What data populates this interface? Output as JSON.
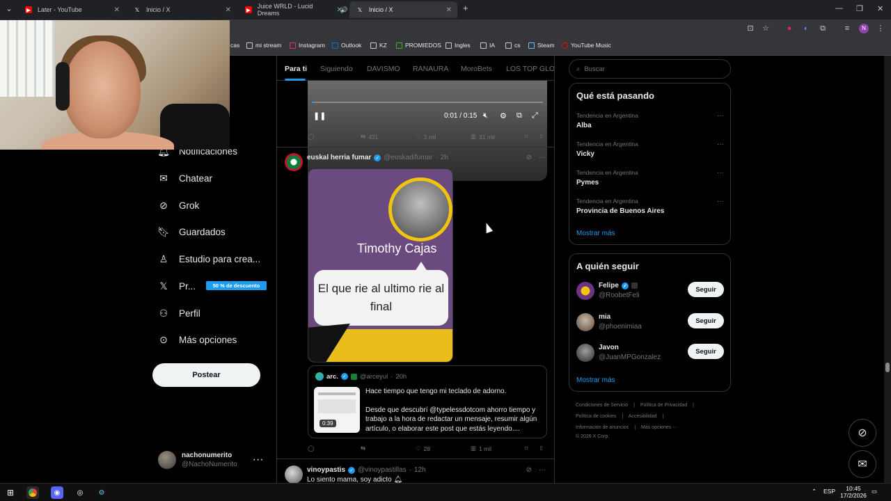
{
  "browser": {
    "tabs": [
      {
        "title": "Later - YouTube",
        "active": false
      },
      {
        "title": "Inicio / X",
        "active": false
      },
      {
        "title": "Juice WRLD - Lucid Dreams",
        "active": false
      },
      {
        "title": "Inicio / X",
        "active": true
      }
    ],
    "new_tab": "+",
    "bookmarks": [
      "cas",
      "mi stream",
      "Instagram",
      "Outlook",
      "KZ",
      "PROMIEDOS",
      "Ingles",
      "IA",
      "cs",
      "Steam",
      "YouTube Music"
    ],
    "profile_initial": "N"
  },
  "nav": {
    "items": [
      {
        "label": "Notificaciones",
        "icon": "bell-icon"
      },
      {
        "label": "Chatear",
        "icon": "mail-icon"
      },
      {
        "label": "Grok",
        "icon": "grok-icon"
      },
      {
        "label": "Guardados",
        "icon": "bookmark-icon"
      },
      {
        "label": "Estudio para crea...",
        "icon": "studio-icon"
      },
      {
        "label": "Pr...",
        "icon": "x-logo-icon"
      },
      {
        "label": "Perfil",
        "icon": "person-icon"
      },
      {
        "label": "Más opciones",
        "icon": "more-circle-icon"
      }
    ],
    "premium_badge": "50 % de descuento",
    "post_button": "Postear",
    "account": {
      "name": "nachonumerito",
      "handle": "@NachoNumerito"
    }
  },
  "feed": {
    "tabs": [
      "Para ti",
      "Siguiendo",
      "DAVISMO",
      "RANAURA",
      "MoroBets",
      "LOS TOP GLOBA"
    ],
    "video": {
      "time": "0:01 / 0:15",
      "progress": 0.01
    },
    "first_actions": {
      "retweets": "431",
      "likes": "3 mil",
      "views": "31 mil"
    },
    "tweet": {
      "name": "euskal herria fumar",
      "handle": "@euskadifumar",
      "time": "2h",
      "image_name": "Timothy Cajas",
      "image_caption": "El que rie al ultimo rie al final",
      "quote": {
        "name": "arc.",
        "handle": "@arceyul",
        "time": "20h",
        "duration": "0:39",
        "line1": "Hace tiempo que tengo mi teclado de adorno.",
        "line2": "Desde que descubrí @typelessdotcom ahorro tiempo y trabajo a la hora de redactar un mensaje, resumir algún artículo, o elaborar este post que estás leyendo...."
      },
      "actions": {
        "likes": "28",
        "views": "1 mil"
      }
    },
    "next_tweet": {
      "name": "vinoypastis",
      "handle": "@vinoypastillas",
      "time": "12h",
      "text": "Lo siento mama, soy adicto"
    }
  },
  "sidebar": {
    "search_placeholder": "Buscar",
    "trending_title": "Qué está pasando",
    "trends": [
      {
        "context": "Tendencia en Argentina",
        "topic": "Alba"
      },
      {
        "context": "Tendencia en Argentina",
        "topic": "Vicky"
      },
      {
        "context": "Tendencia en Argentina",
        "topic": "Pymes"
      },
      {
        "context": "Tendencia en Argentina",
        "topic": "Provincia de Buenos Aires"
      }
    ],
    "show_more": "Mostrar más",
    "follow_title": "A quién seguir",
    "follows": [
      {
        "name": "Felipe",
        "handle": "@RoobetFeli",
        "button": "Seguir"
      },
      {
        "name": "mia",
        "handle": "@phoenimiaa",
        "button": "Seguir"
      },
      {
        "name": "Javon",
        "handle": "@JuanMPGonzalez",
        "button": "Seguir"
      }
    ],
    "footer": {
      "line1": [
        "Condiciones de Servicio",
        "Política de Privacidad"
      ],
      "line2": [
        "Política de cookies",
        "Accesibilidad"
      ],
      "line3": [
        "Información de anuncios",
        "Más opciones ···"
      ],
      "copyright": "© 2026 X Corp."
    }
  },
  "taskbar": {
    "lang": "ESP",
    "time": "10:45",
    "date": "17/2/2026"
  },
  "colors": {
    "accent": "#1d9bf0",
    "background": "#000000",
    "border": "#2f3336"
  }
}
